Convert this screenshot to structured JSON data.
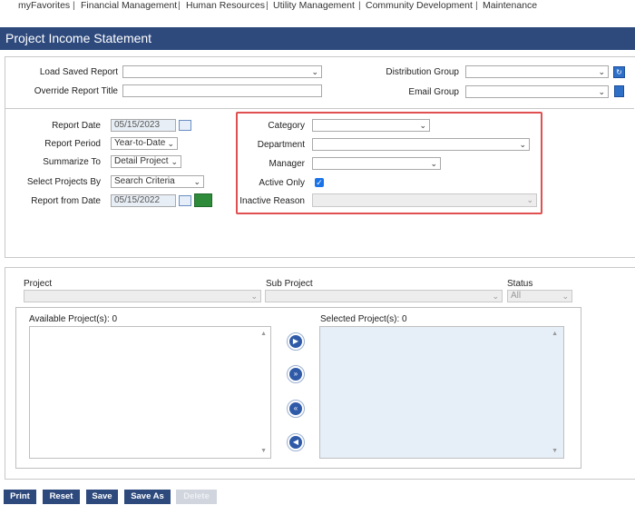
{
  "topnav": {
    "items": [
      "myFavorites",
      "Financial Management",
      "Human Resources",
      "Utility Management",
      "Community Development",
      "Maintenance"
    ],
    "separator": "|"
  },
  "page_title": "Project Income Statement",
  "report_header": {
    "load_saved_report_label": "Load Saved Report",
    "override_report_title_label": "Override Report Title",
    "distribution_group_label": "Distribution Group",
    "email_group_label": "Email Group"
  },
  "report_options": {
    "report_date_label": "Report Date",
    "report_date_value": "05/15/2023",
    "report_period_label": "Report Period",
    "report_period_value": "Year-to-Date",
    "summarize_to_label": "Summarize To",
    "summarize_to_value": "Detail Project",
    "select_projects_by_label": "Select Projects By",
    "select_projects_by_value": "Search Criteria",
    "report_from_date_label": "Report from Date",
    "report_from_date_value": "05/15/2022"
  },
  "criteria": {
    "category_label": "Category",
    "department_label": "Department",
    "manager_label": "Manager",
    "active_only_label": "Active Only",
    "active_only_checked": true,
    "inactive_reason_label": "Inactive Reason"
  },
  "project_filter": {
    "project_label": "Project",
    "sub_project_label": "Sub Project",
    "status_label": "Status",
    "status_value": "All",
    "available_label": "Available Project(s): 0",
    "selected_label": "Selected Project(s): 0"
  },
  "footer_buttons": {
    "print": "Print",
    "reset": "Reset",
    "save": "Save",
    "save_as": "Save As",
    "delete": "Delete"
  },
  "colors": {
    "header": "#2e4a7d",
    "highlight": "#e05050",
    "checkbox": "#1a73e8"
  }
}
